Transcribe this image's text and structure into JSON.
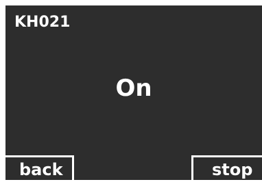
{
  "display": {
    "device_id": "KH021",
    "status": "On"
  },
  "softkeys": {
    "left_label": "back",
    "right_label": "stop"
  },
  "colors": {
    "screen_background": "#2d2d2d",
    "foreground": "#ffffff",
    "page_background": "#ffffff"
  }
}
